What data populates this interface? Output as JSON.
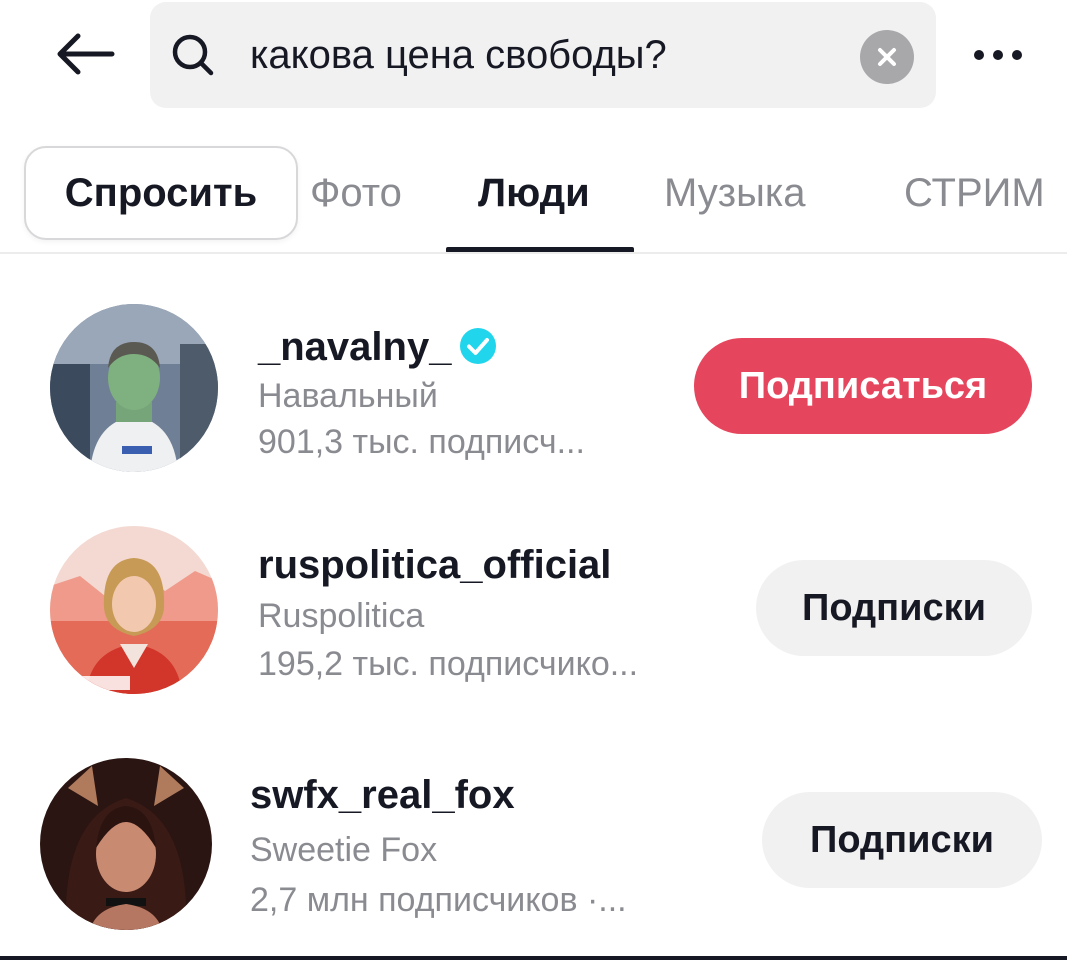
{
  "header": {
    "back_icon": "arrow-left-icon",
    "search_icon": "search-icon",
    "search_query": "какова цена свободы?",
    "clear_icon": "clear-icon",
    "more_icon": "more-icon"
  },
  "tabs": [
    {
      "label": "Спросить",
      "active": false,
      "style": "chip"
    },
    {
      "label": "Фото",
      "active": false
    },
    {
      "label": "Люди",
      "active": true
    },
    {
      "label": "Музыка",
      "active": false
    },
    {
      "label": "СТРИМ",
      "active": false
    }
  ],
  "users": [
    {
      "username": "_navalny_",
      "verified": true,
      "display_name": "Навальный",
      "followers": "901,3 тыс. подписч...",
      "button_label": "Подписаться",
      "button_state": "follow"
    },
    {
      "username": "ruspolitica_official",
      "verified": false,
      "display_name": "Ruspolitica",
      "followers": "195,2 тыс. подписчико...",
      "button_label": "Подписки",
      "button_state": "following"
    },
    {
      "username": "swfx_real_fox",
      "verified": false,
      "display_name": "Sweetie Fox",
      "followers": "2,7 млн подписчиков ·...",
      "button_label": "Подписки",
      "button_state": "following"
    }
  ],
  "colors": {
    "follow_button": "#e6465d",
    "verified_badge": "#20d5ec",
    "secondary_text": "#8a8b91",
    "primary_text": "#161823"
  }
}
